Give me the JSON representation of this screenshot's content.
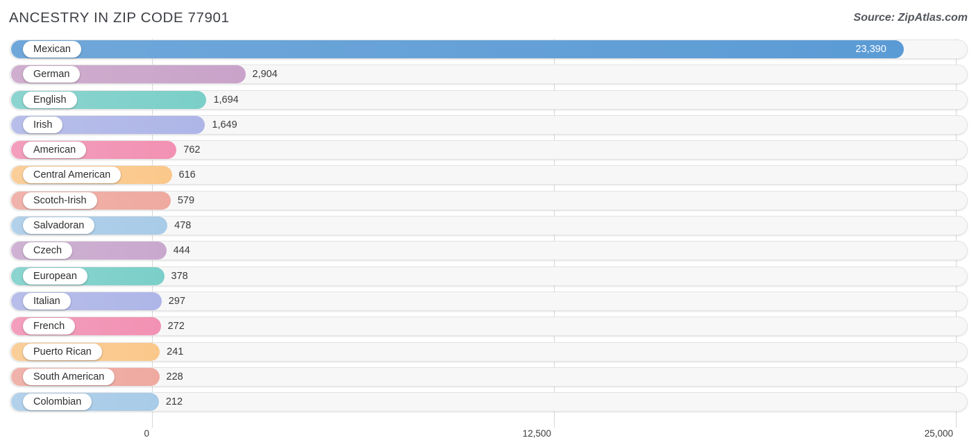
{
  "header": {
    "title": "ANCESTRY IN ZIP CODE 77901",
    "source": "Source: ZipAtlas.com"
  },
  "chart_data": {
    "type": "bar",
    "orientation": "horizontal",
    "title": "ANCESTRY IN ZIP CODE 77901",
    "subtitle": "",
    "xlabel": "",
    "ylabel": "",
    "xlim": [
      0,
      25000
    ],
    "grid": true,
    "legend": "none",
    "ticks": [
      "0",
      "12,500",
      "25,000"
    ],
    "tick_values": [
      0,
      12500,
      25000
    ],
    "categories": [
      "Mexican",
      "German",
      "English",
      "Irish",
      "American",
      "Central American",
      "Scotch-Irish",
      "Salvadoran",
      "Czech",
      "European",
      "Italian",
      "French",
      "Puerto Rican",
      "South American",
      "Colombian"
    ],
    "values": [
      23390,
      2904,
      1694,
      1649,
      762,
      616,
      579,
      478,
      444,
      378,
      297,
      272,
      241,
      228,
      212
    ],
    "value_labels": [
      "23,390",
      "2,904",
      "1,694",
      "1,649",
      "762",
      "616",
      "579",
      "478",
      "444",
      "378",
      "297",
      "272",
      "241",
      "228",
      "212"
    ],
    "colors": [
      "#5b9bd5",
      "#c9a3c9",
      "#7bcfc9",
      "#aeb6e8",
      "#f291b3",
      "#fbc88b",
      "#efa9a0",
      "#a8cbe8",
      "#c9a8ce",
      "#7bcfc9",
      "#aeb6e8",
      "#f291b3",
      "#fbc88b",
      "#efa9a0",
      "#a8cbe8"
    ],
    "bars": [
      {
        "label": "Mexican",
        "value": 23390,
        "value_label": "23,390",
        "color": "#5b9bd5",
        "label_inside_bar": true
      },
      {
        "label": "German",
        "value": 2904,
        "value_label": "2,904",
        "color": "#c9a3c9",
        "label_inside_bar": false
      },
      {
        "label": "English",
        "value": 1694,
        "value_label": "1,694",
        "color": "#7bcfc9",
        "label_inside_bar": false
      },
      {
        "label": "Irish",
        "value": 1649,
        "value_label": "1,649",
        "color": "#aeb6e8",
        "label_inside_bar": false
      },
      {
        "label": "American",
        "value": 762,
        "value_label": "762",
        "color": "#f291b3",
        "label_inside_bar": false
      },
      {
        "label": "Central American",
        "value": 616,
        "value_label": "616",
        "color": "#fbc88b",
        "label_inside_bar": false
      },
      {
        "label": "Scotch-Irish",
        "value": 579,
        "value_label": "579",
        "color": "#efa9a0",
        "label_inside_bar": false
      },
      {
        "label": "Salvadoran",
        "value": 478,
        "value_label": "478",
        "color": "#a8cbe8",
        "label_inside_bar": false
      },
      {
        "label": "Czech",
        "value": 444,
        "value_label": "444",
        "color": "#c9a8ce",
        "label_inside_bar": false
      },
      {
        "label": "European",
        "value": 378,
        "value_label": "378",
        "color": "#7bcfc9",
        "label_inside_bar": false
      },
      {
        "label": "Italian",
        "value": 297,
        "value_label": "297",
        "color": "#aeb6e8",
        "label_inside_bar": false
      },
      {
        "label": "French",
        "value": 272,
        "value_label": "272",
        "color": "#f291b3",
        "label_inside_bar": false
      },
      {
        "label": "Puerto Rican",
        "value": 241,
        "value_label": "241",
        "color": "#fbc88b",
        "label_inside_bar": false
      },
      {
        "label": "South American",
        "value": 228,
        "value_label": "228",
        "color": "#efa9a0",
        "label_inside_bar": false
      },
      {
        "label": "Colombian",
        "value": 212,
        "value_label": "212",
        "color": "#a8cbe8",
        "label_inside_bar": false
      }
    ]
  }
}
